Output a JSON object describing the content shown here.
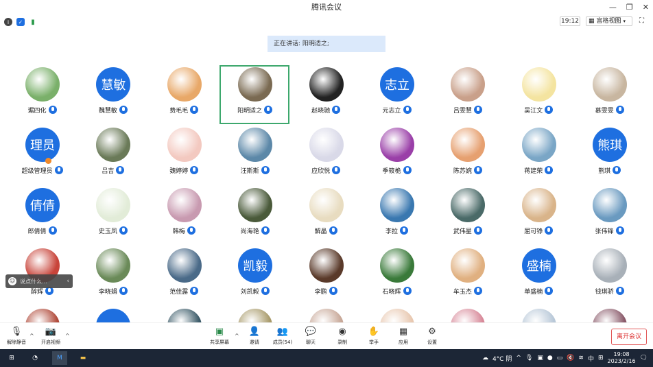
{
  "window": {
    "title": "腾讯会议"
  },
  "topbar": {
    "clock": "19:12",
    "view_label": "宫格视图"
  },
  "speaking": {
    "text": "正在讲话: 阳明适之;"
  },
  "grid": {
    "participants": [
      {
        "name": "琚四化",
        "avatar": "photo",
        "color": "#7ab06a"
      },
      {
        "name": "魏慧敏",
        "avatar": "text",
        "text": "慧敏",
        "color": "#1e6fe0"
      },
      {
        "name": "费毛毛",
        "avatar": "photo",
        "color": "#e8a868"
      },
      {
        "name": "阳明适之",
        "avatar": "photo",
        "color": "#7a6a52"
      },
      {
        "name": "赵晓驰",
        "avatar": "photo",
        "color": "#222222"
      },
      {
        "name": "元志立",
        "avatar": "text",
        "text": "志立",
        "color": "#1e6fe0"
      },
      {
        "name": "吕雯慧",
        "avatar": "photo",
        "color": "#c9a08a"
      },
      {
        "name": "吴江文",
        "avatar": "photo",
        "color": "#f4e4a0"
      },
      {
        "name": "慕雯雯",
        "avatar": "photo",
        "color": "#c8b6a0"
      },
      {
        "name": "超级管理员",
        "avatar": "text",
        "text": "理员",
        "color": "#1e6fe0"
      },
      {
        "name": "吕吉",
        "avatar": "photo",
        "color": "#6a7a58"
      },
      {
        "name": "魏婷婷",
        "avatar": "photo",
        "color": "#f3c9c0"
      },
      {
        "name": "汪斯斯",
        "avatar": "photo",
        "color": "#5c88a8"
      },
      {
        "name": "应欣悦",
        "avatar": "photo",
        "color": "#d9d9e8"
      },
      {
        "name": "季筱桅",
        "avatar": "photo",
        "color": "#9a3fa8"
      },
      {
        "name": "陈苏婉",
        "avatar": "photo",
        "color": "#e6a070"
      },
      {
        "name": "蒋建荣",
        "avatar": "photo",
        "color": "#7aa6c6"
      },
      {
        "name": "熊琪",
        "avatar": "text",
        "text": "熊琪",
        "color": "#1e6fe0"
      },
      {
        "name": "郎倩倩",
        "avatar": "text",
        "text": "倩倩",
        "color": "#1e6fe0"
      },
      {
        "name": "史玉凤",
        "avatar": "photo",
        "color": "#e2ecd8"
      },
      {
        "name": "韩梅",
        "avatar": "photo",
        "color": "#c89ab0"
      },
      {
        "name": "尚海艳",
        "avatar": "photo",
        "color": "#4a5a3a"
      },
      {
        "name": "解晶",
        "avatar": "photo",
        "color": "#e8dcc0"
      },
      {
        "name": "李拉",
        "avatar": "photo",
        "color": "#3a78b0"
      },
      {
        "name": "武伟星",
        "avatar": "photo",
        "color": "#4a6a68"
      },
      {
        "name": "屈可铮",
        "avatar": "photo",
        "color": "#d9b48a"
      },
      {
        "name": "张伟锋",
        "avatar": "photo",
        "color": "#6a9ac0"
      },
      {
        "name": "醉辉",
        "avatar": "photo",
        "color": "#c8443a"
      },
      {
        "name": "李晓娟",
        "avatar": "photo",
        "color": "#6a8a58"
      },
      {
        "name": "范佳露",
        "avatar": "photo",
        "color": "#4a6a88"
      },
      {
        "name": "刘凯毅",
        "avatar": "text",
        "text": "凯毅",
        "color": "#1e6fe0"
      },
      {
        "name": "李鹏",
        "avatar": "photo",
        "color": "#5a3a2a"
      },
      {
        "name": "石晓辉",
        "avatar": "photo",
        "color": "#3a7a3a"
      },
      {
        "name": "牟玉杰",
        "avatar": "photo",
        "color": "#e0b080"
      },
      {
        "name": "单盛楠",
        "avatar": "text",
        "text": "盛楠",
        "color": "#1e6fe0"
      },
      {
        "name": "钱琪骄",
        "avatar": "photo",
        "color": "#a8b0b8"
      },
      {
        "name": "",
        "avatar": "photo",
        "color": "#b04a3a"
      },
      {
        "name": "",
        "avatar": "text",
        "text": "",
        "color": "#1e6fe0"
      },
      {
        "name": "",
        "avatar": "photo",
        "color": "#3a5a68"
      },
      {
        "name": "",
        "avatar": "photo",
        "color": "#a89a6a"
      },
      {
        "name": "",
        "avatar": "photo",
        "color": "#c8a898"
      },
      {
        "name": "",
        "avatar": "photo",
        "color": "#e8c8b0"
      },
      {
        "name": "",
        "avatar": "photo",
        "color": "#d88a9a"
      },
      {
        "name": "",
        "avatar": "photo",
        "color": "#b8c8d8"
      },
      {
        "name": "",
        "avatar": "photo",
        "color": "#8a5a6a"
      }
    ]
  },
  "chat_float": {
    "placeholder": "说点什么..."
  },
  "toolbar": {
    "mute": "解除静音",
    "video": "开启视频",
    "share": "共享屏幕",
    "invite": "邀请",
    "members": "成员(54)",
    "chat": "聊天",
    "record": "录制",
    "raise": "举手",
    "apps": "应用",
    "settings": "设置",
    "leave": "离开会议"
  },
  "taskbar": {
    "weather": "4°C 阴",
    "ime": "中",
    "time": "19:08",
    "date": "2023/2/16"
  }
}
